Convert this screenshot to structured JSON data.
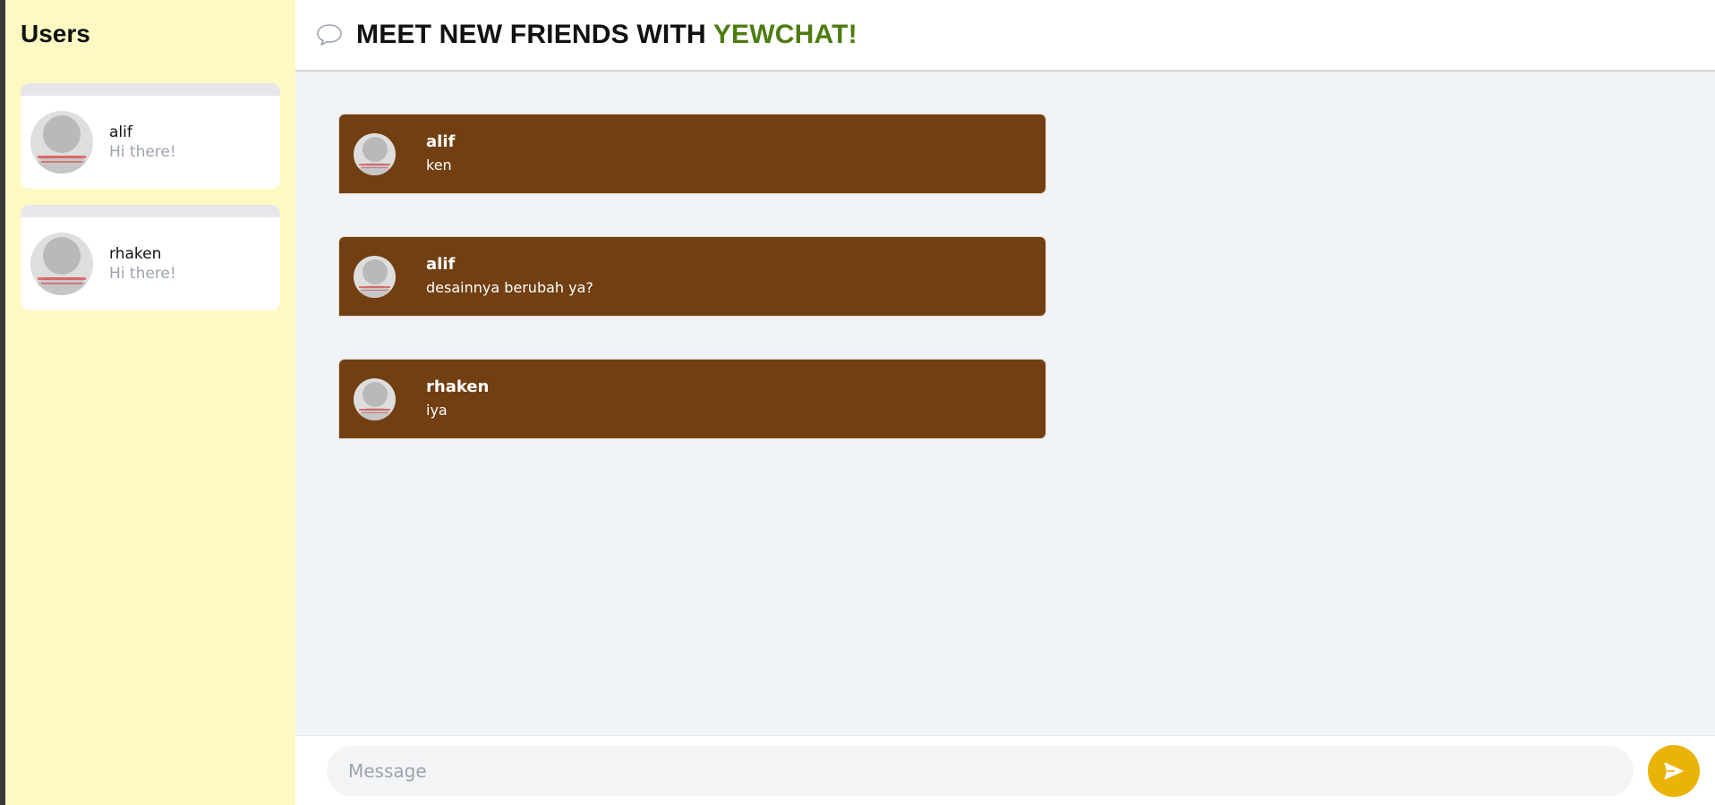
{
  "sidebar": {
    "title": "Users",
    "users": [
      {
        "name": "alif",
        "status": "Hi there!"
      },
      {
        "name": "rhaken",
        "status": "Hi there!"
      }
    ]
  },
  "header": {
    "title_prefix": "MEET NEW FRIENDS WITH ",
    "title_brand": "YEWCHAT!",
    "icon": "speech-bubble-icon",
    "brand_color": "#4d7c0f"
  },
  "messages": [
    {
      "user": "alif",
      "text": "ken"
    },
    {
      "user": "alif",
      "text": "desainnya berubah ya?"
    },
    {
      "user": "rhaken",
      "text": "iya"
    }
  ],
  "composer": {
    "placeholder": "Message",
    "send_icon": "send-icon"
  },
  "colors": {
    "sidebar_bg": "#fef9c3",
    "message_bg": "#713f12",
    "send_button": "#eab308"
  }
}
